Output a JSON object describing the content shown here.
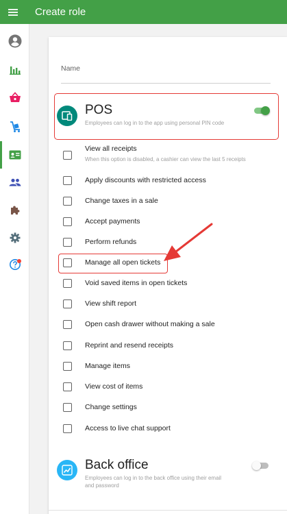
{
  "header": {
    "title": "Create role"
  },
  "sidebar": {
    "items": [
      {
        "icon": "account-circle-icon",
        "active": false
      },
      {
        "icon": "bar-chart-icon",
        "active": false
      },
      {
        "icon": "basket-icon",
        "active": false
      },
      {
        "icon": "inventory-cart-icon",
        "active": false
      },
      {
        "icon": "badge-card-icon",
        "active": true
      },
      {
        "icon": "people-icon",
        "active": false
      },
      {
        "icon": "puzzle-icon",
        "active": false
      },
      {
        "icon": "gear-icon",
        "active": false
      },
      {
        "icon": "help-icon",
        "active": false,
        "badge": true
      }
    ]
  },
  "form": {
    "name_label": "Name",
    "pos": {
      "title": "POS",
      "description": "Employees can log in to the app using personal PIN code",
      "enabled": true
    },
    "permissions": [
      {
        "label": "View all receipts",
        "sublabel": "When this option is disabled, a cashier can view the last 5 receipts",
        "checked": false
      },
      {
        "label": "Apply discounts with restricted access",
        "checked": false
      },
      {
        "label": "Change taxes in a sale",
        "checked": false
      },
      {
        "label": "Accept payments",
        "checked": false
      },
      {
        "label": "Perform refunds",
        "checked": false
      },
      {
        "label": "Manage all open tickets",
        "checked": false,
        "highlighted": true
      },
      {
        "label": "Void saved items in open tickets",
        "checked": false
      },
      {
        "label": "View shift report",
        "checked": false
      },
      {
        "label": "Open cash drawer without making a sale",
        "checked": false
      },
      {
        "label": "Reprint and resend receipts",
        "checked": false
      },
      {
        "label": "Manage items",
        "checked": false
      },
      {
        "label": "View cost of items",
        "checked": false
      },
      {
        "label": "Change settings",
        "checked": false
      },
      {
        "label": "Access to live chat support",
        "checked": false
      }
    ],
    "back_office": {
      "title": "Back office",
      "description": "Employees can log in to the back office using their email and password",
      "enabled": false
    }
  },
  "colors": {
    "brand_green": "#43a047",
    "pos_icon": "#00897b",
    "back_office_icon": "#29b6f6",
    "annotation_red": "#e53935"
  }
}
